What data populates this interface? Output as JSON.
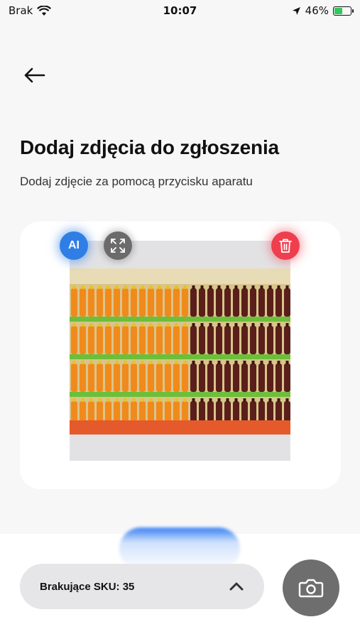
{
  "status_bar": {
    "carrier": "Brak",
    "time": "10:07",
    "battery_percent": "46%",
    "battery_level": 0.46
  },
  "header": {
    "title": "Dodaj zdjęcia do zgłoszenia",
    "subtitle": "Dodaj zdjęcie za pomocą przycisku aparatu"
  },
  "photo_card": {
    "ai_label": "AI",
    "icons": [
      "expand-icon",
      "trash-icon"
    ],
    "accent_blue": "#2f7ee6",
    "accent_red": "#ef3f4f"
  },
  "bottom": {
    "missing_sku_label": "Brakujące SKU: 35",
    "camera_icon": "camera-icon"
  }
}
